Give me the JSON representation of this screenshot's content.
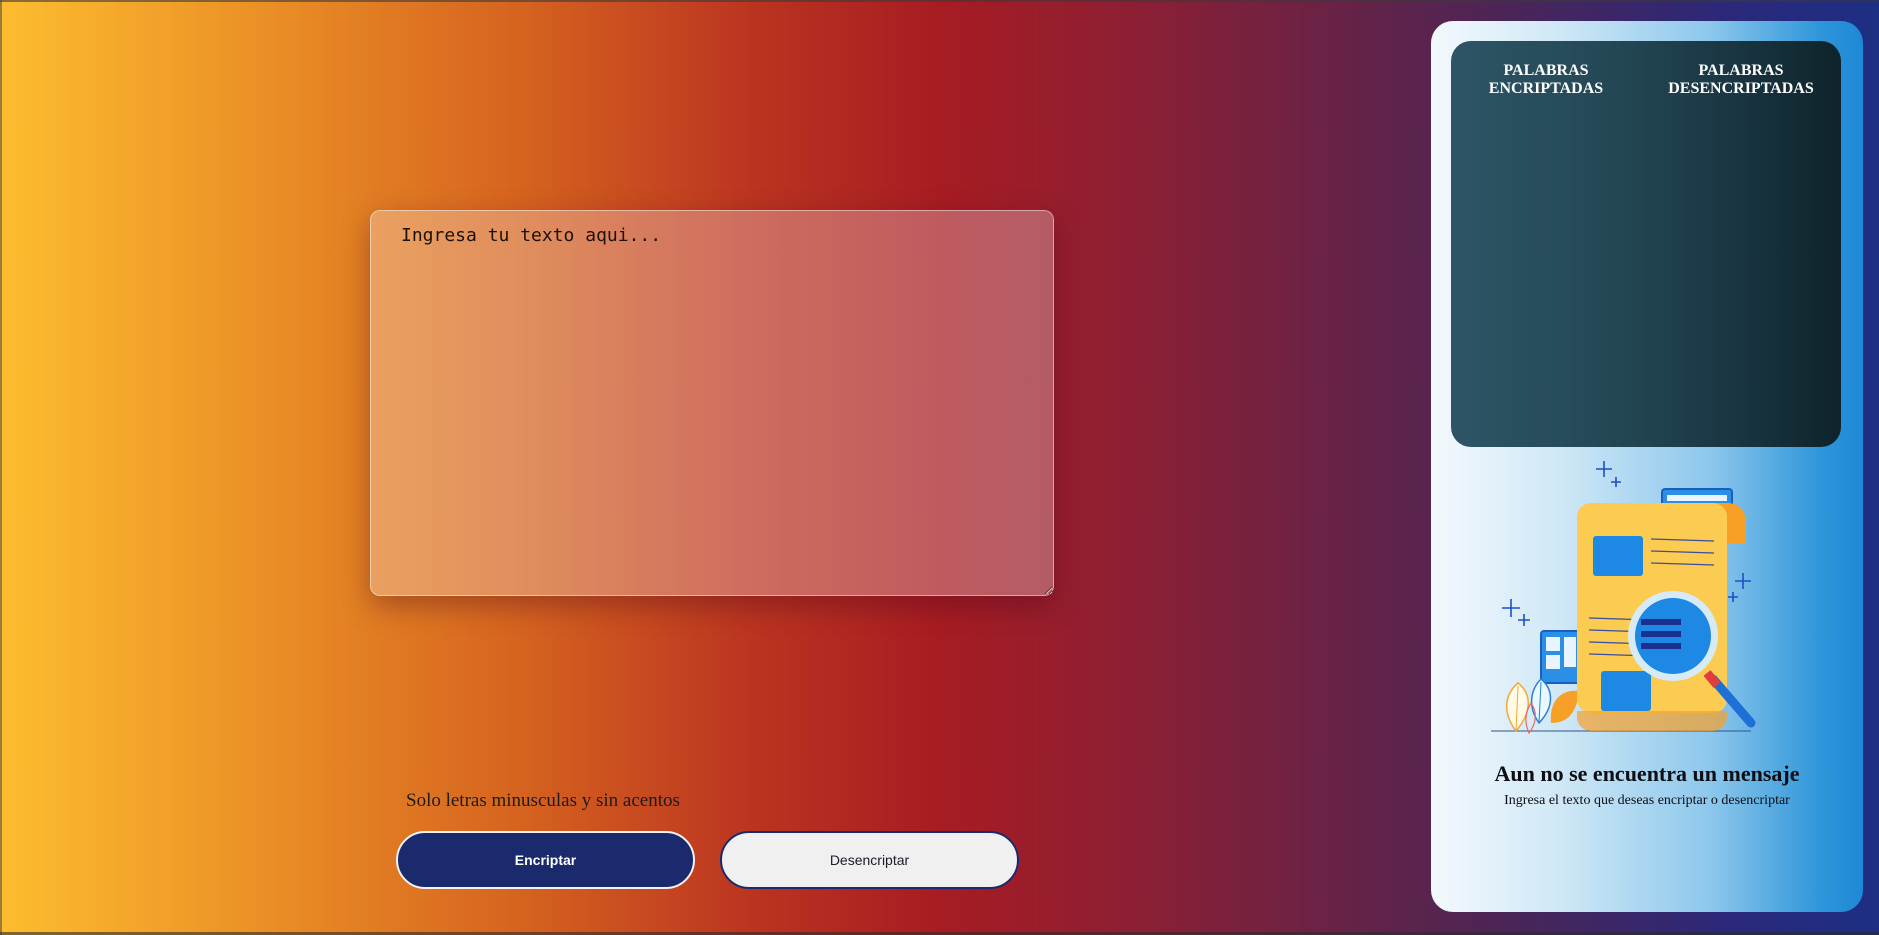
{
  "input": {
    "placeholder": "Ingresa tu texto aqui..."
  },
  "hint": "Solo letras minusculas y sin acentos",
  "buttons": {
    "encrypt": "Encriptar",
    "decrypt": "Desencriptar"
  },
  "output": {
    "encrypted_title": "PALABRAS ENCRIPTADAS",
    "decrypted_title": "PALABRAS DESENCRIPTADAS"
  },
  "empty_state": {
    "title": "Aun no se encuentra un mensaje",
    "subtitle": "Ingresa el texto que deseas encriptar o desencriptar",
    "illustration": "document-magnifier-illustration"
  },
  "colors": {
    "accent": "#1b2a6d",
    "panel_dark": "#1f3c49",
    "panel_light": "#2f96da"
  }
}
